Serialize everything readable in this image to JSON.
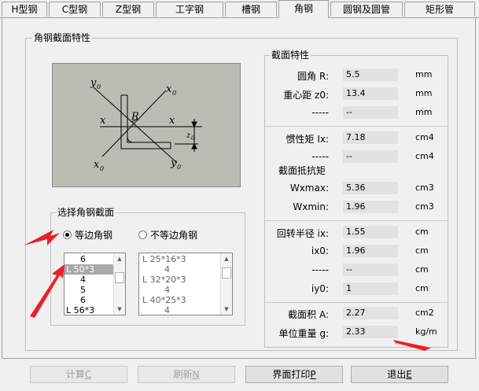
{
  "tabs": [
    "H型钢",
    "C型钢",
    "Z型钢",
    "工字钢",
    "槽钢",
    "角钢",
    "圆钢及圆管",
    "矩形管"
  ],
  "active_tab": "角钢",
  "section_group": {
    "title": "角钢截面特性"
  },
  "diagram_labels": {
    "y0_top": "y",
    "x0_top": "x",
    "R": "R",
    "x_left": "x",
    "x_right": "x",
    "z0": "z",
    "x0_bottom": "x",
    "y0_bottom": "y",
    "sub0": "0"
  },
  "select_group": {
    "title": "选择角钢截面",
    "radio_equal": "等边角钢",
    "radio_unequal": "不等边角钢",
    "equal_selected": true
  },
  "list_equal": [
    "6",
    "L 50*3",
    "4",
    "5",
    "6",
    "L 56*3"
  ],
  "list_equal_selected": 1,
  "list_unequal": [
    "L 25*16*3",
    "4",
    "L 32*20*3",
    "4",
    "L 40*25*3",
    "4"
  ],
  "props": {
    "title": "截面特性",
    "subtitle2": "截面抵抗矩",
    "rows": [
      {
        "label": "圆角  R:",
        "value": "5.5",
        "unit": "mm"
      },
      {
        "label": "重心距 z0:",
        "value": "13.4",
        "unit": "mm"
      },
      {
        "label": "-----",
        "value": "--",
        "unit": "mm"
      },
      {
        "label": "惯性矩 Ix:",
        "value": "7.18",
        "unit": "cm4"
      },
      {
        "label": "-----",
        "value": "--",
        "unit": "cm4"
      },
      {
        "label": "Wxmax:",
        "value": "5.36",
        "unit": "cm3"
      },
      {
        "label": "Wxmin:",
        "value": "1.96",
        "unit": "cm3"
      },
      {
        "label": "回转半径 ix:",
        "value": "1.55",
        "unit": "cm"
      },
      {
        "label": "ix0:",
        "value": "1.96",
        "unit": "cm"
      },
      {
        "label": "-----",
        "value": "--",
        "unit": "cm"
      },
      {
        "label": "iy0:",
        "value": "1",
        "unit": "cm"
      },
      {
        "label": "截面积 A:",
        "value": "2.27",
        "unit": "cm2"
      },
      {
        "label": "单位重量 g:",
        "value": "2.33",
        "unit": "kg/m"
      }
    ]
  },
  "buttons": {
    "calc": "计算",
    "calc_key": "C",
    "refresh": "刷新",
    "refresh_key": "N",
    "print": "界面打印",
    "print_key": "P",
    "exit": "退出",
    "exit_key": "E"
  },
  "colors": {
    "annotation_arrow": "#e8212a",
    "drawing_bg": "#b9bdb4"
  }
}
